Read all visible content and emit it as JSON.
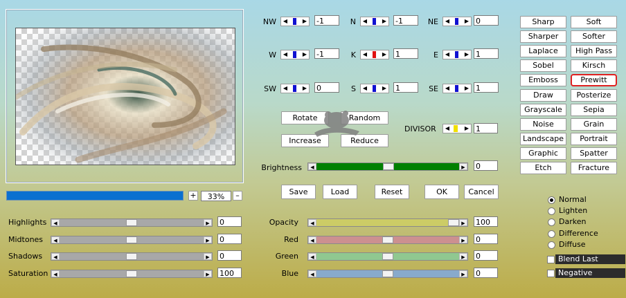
{
  "matrix": {
    "rows": [
      [
        {
          "label": "NW",
          "value": "-1",
          "marker": "#1010d0"
        },
        {
          "label": "N",
          "value": "-1",
          "marker": "#1010d0"
        },
        {
          "label": "NE",
          "value": "0",
          "marker": "#1010d0"
        }
      ],
      [
        {
          "label": "W",
          "value": "-1",
          "marker": "#1010d0"
        },
        {
          "label": "K",
          "value": "1",
          "marker": "#e01010"
        },
        {
          "label": "E",
          "value": "1",
          "marker": "#1010d0"
        }
      ],
      [
        {
          "label": "SW",
          "value": "0",
          "marker": "#1010d0"
        },
        {
          "label": "S",
          "value": "1",
          "marker": "#1010d0"
        },
        {
          "label": "SE",
          "value": "1",
          "marker": "#1010d0"
        }
      ]
    ],
    "divisor": {
      "label": "DIVISOR",
      "value": "1",
      "marker": "#f0e000"
    }
  },
  "buttons": {
    "rotate": "Rotate",
    "random": "Random",
    "increase": "Increase",
    "reduce": "Reduce",
    "save": "Save",
    "load": "Load",
    "reset": "Reset",
    "ok": "OK",
    "cancel": "Cancel"
  },
  "presets": [
    "Sharp",
    "Soft",
    "Sharper",
    "Softer",
    "Laplace",
    "High Pass",
    "Sobel",
    "Kirsch",
    "Emboss",
    "Prewitt",
    "Draw",
    "Posterize",
    "Grayscale",
    "Sepia",
    "Noise",
    "Grain",
    "Landscape",
    "Portrait",
    "Graphic",
    "Spatter",
    "Etch",
    "Fracture"
  ],
  "selected_preset": "Prewitt",
  "zoom": {
    "plus": "+",
    "minus": "–",
    "value": "33%"
  },
  "brightness": {
    "label": "Brightness",
    "value": "0",
    "level": 0.5,
    "color": "#008000"
  },
  "tone_sliders": [
    {
      "label": "Highlights",
      "value": "0",
      "level": 0.5,
      "color": "#a8a8a8"
    },
    {
      "label": "Midtones",
      "value": "0",
      "level": 0.5,
      "color": "#a8a8a8"
    },
    {
      "label": "Shadows",
      "value": "0",
      "level": 0.5,
      "color": "#a8a8a8"
    },
    {
      "label": "Saturation",
      "value": "100",
      "level": 0.5,
      "color": "#a8a8a8"
    }
  ],
  "channel_sliders": [
    {
      "label": "Opacity",
      "value": "100",
      "level": 1.0,
      "color": "#cccc66"
    },
    {
      "label": "Red",
      "value": "0",
      "level": 0.5,
      "color": "#cc9090"
    },
    {
      "label": "Green",
      "value": "0",
      "level": 0.5,
      "color": "#90c890"
    },
    {
      "label": "Blue",
      "value": "0",
      "level": 0.5,
      "color": "#88aacc"
    }
  ],
  "blend_modes": [
    {
      "label": "Normal",
      "checked": true
    },
    {
      "label": "Lighten",
      "checked": false
    },
    {
      "label": "Darken",
      "checked": false
    },
    {
      "label": "Difference",
      "checked": false
    },
    {
      "label": "Diffuse",
      "checked": false
    }
  ],
  "options": {
    "blend_last": "Blend Last",
    "negative": "Negative"
  },
  "colors": {
    "progress": "#0a70d0",
    "highlight_border": "#e02020"
  }
}
